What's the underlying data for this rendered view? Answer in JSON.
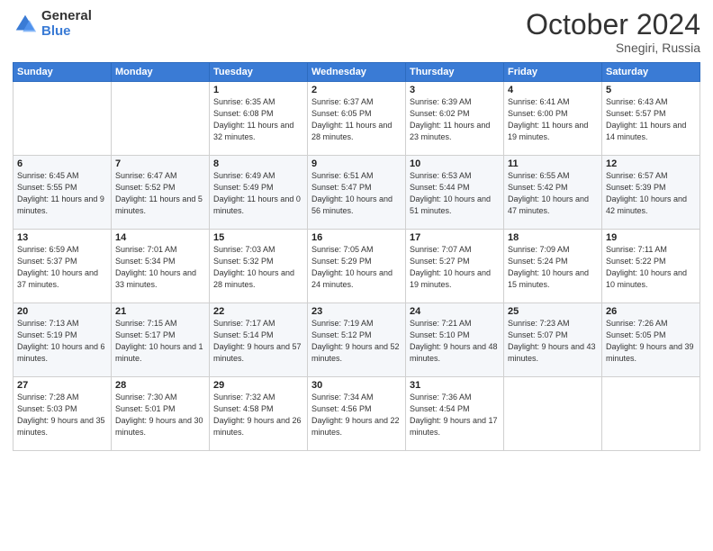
{
  "header": {
    "logo_general": "General",
    "logo_blue": "Blue",
    "month": "October 2024",
    "location": "Snegiri, Russia"
  },
  "days_of_week": [
    "Sunday",
    "Monday",
    "Tuesday",
    "Wednesday",
    "Thursday",
    "Friday",
    "Saturday"
  ],
  "weeks": [
    [
      {
        "day": "",
        "content": ""
      },
      {
        "day": "",
        "content": ""
      },
      {
        "day": "1",
        "content": "Sunrise: 6:35 AM\nSunset: 6:08 PM\nDaylight: 11 hours and 32 minutes."
      },
      {
        "day": "2",
        "content": "Sunrise: 6:37 AM\nSunset: 6:05 PM\nDaylight: 11 hours and 28 minutes."
      },
      {
        "day": "3",
        "content": "Sunrise: 6:39 AM\nSunset: 6:02 PM\nDaylight: 11 hours and 23 minutes."
      },
      {
        "day": "4",
        "content": "Sunrise: 6:41 AM\nSunset: 6:00 PM\nDaylight: 11 hours and 19 minutes."
      },
      {
        "day": "5",
        "content": "Sunrise: 6:43 AM\nSunset: 5:57 PM\nDaylight: 11 hours and 14 minutes."
      }
    ],
    [
      {
        "day": "6",
        "content": "Sunrise: 6:45 AM\nSunset: 5:55 PM\nDaylight: 11 hours and 9 minutes."
      },
      {
        "day": "7",
        "content": "Sunrise: 6:47 AM\nSunset: 5:52 PM\nDaylight: 11 hours and 5 minutes."
      },
      {
        "day": "8",
        "content": "Sunrise: 6:49 AM\nSunset: 5:49 PM\nDaylight: 11 hours and 0 minutes."
      },
      {
        "day": "9",
        "content": "Sunrise: 6:51 AM\nSunset: 5:47 PM\nDaylight: 10 hours and 56 minutes."
      },
      {
        "day": "10",
        "content": "Sunrise: 6:53 AM\nSunset: 5:44 PM\nDaylight: 10 hours and 51 minutes."
      },
      {
        "day": "11",
        "content": "Sunrise: 6:55 AM\nSunset: 5:42 PM\nDaylight: 10 hours and 47 minutes."
      },
      {
        "day": "12",
        "content": "Sunrise: 6:57 AM\nSunset: 5:39 PM\nDaylight: 10 hours and 42 minutes."
      }
    ],
    [
      {
        "day": "13",
        "content": "Sunrise: 6:59 AM\nSunset: 5:37 PM\nDaylight: 10 hours and 37 minutes."
      },
      {
        "day": "14",
        "content": "Sunrise: 7:01 AM\nSunset: 5:34 PM\nDaylight: 10 hours and 33 minutes."
      },
      {
        "day": "15",
        "content": "Sunrise: 7:03 AM\nSunset: 5:32 PM\nDaylight: 10 hours and 28 minutes."
      },
      {
        "day": "16",
        "content": "Sunrise: 7:05 AM\nSunset: 5:29 PM\nDaylight: 10 hours and 24 minutes."
      },
      {
        "day": "17",
        "content": "Sunrise: 7:07 AM\nSunset: 5:27 PM\nDaylight: 10 hours and 19 minutes."
      },
      {
        "day": "18",
        "content": "Sunrise: 7:09 AM\nSunset: 5:24 PM\nDaylight: 10 hours and 15 minutes."
      },
      {
        "day": "19",
        "content": "Sunrise: 7:11 AM\nSunset: 5:22 PM\nDaylight: 10 hours and 10 minutes."
      }
    ],
    [
      {
        "day": "20",
        "content": "Sunrise: 7:13 AM\nSunset: 5:19 PM\nDaylight: 10 hours and 6 minutes."
      },
      {
        "day": "21",
        "content": "Sunrise: 7:15 AM\nSunset: 5:17 PM\nDaylight: 10 hours and 1 minute."
      },
      {
        "day": "22",
        "content": "Sunrise: 7:17 AM\nSunset: 5:14 PM\nDaylight: 9 hours and 57 minutes."
      },
      {
        "day": "23",
        "content": "Sunrise: 7:19 AM\nSunset: 5:12 PM\nDaylight: 9 hours and 52 minutes."
      },
      {
        "day": "24",
        "content": "Sunrise: 7:21 AM\nSunset: 5:10 PM\nDaylight: 9 hours and 48 minutes."
      },
      {
        "day": "25",
        "content": "Sunrise: 7:23 AM\nSunset: 5:07 PM\nDaylight: 9 hours and 43 minutes."
      },
      {
        "day": "26",
        "content": "Sunrise: 7:26 AM\nSunset: 5:05 PM\nDaylight: 9 hours and 39 minutes."
      }
    ],
    [
      {
        "day": "27",
        "content": "Sunrise: 7:28 AM\nSunset: 5:03 PM\nDaylight: 9 hours and 35 minutes."
      },
      {
        "day": "28",
        "content": "Sunrise: 7:30 AM\nSunset: 5:01 PM\nDaylight: 9 hours and 30 minutes."
      },
      {
        "day": "29",
        "content": "Sunrise: 7:32 AM\nSunset: 4:58 PM\nDaylight: 9 hours and 26 minutes."
      },
      {
        "day": "30",
        "content": "Sunrise: 7:34 AM\nSunset: 4:56 PM\nDaylight: 9 hours and 22 minutes."
      },
      {
        "day": "31",
        "content": "Sunrise: 7:36 AM\nSunset: 4:54 PM\nDaylight: 9 hours and 17 minutes."
      },
      {
        "day": "",
        "content": ""
      },
      {
        "day": "",
        "content": ""
      }
    ]
  ]
}
